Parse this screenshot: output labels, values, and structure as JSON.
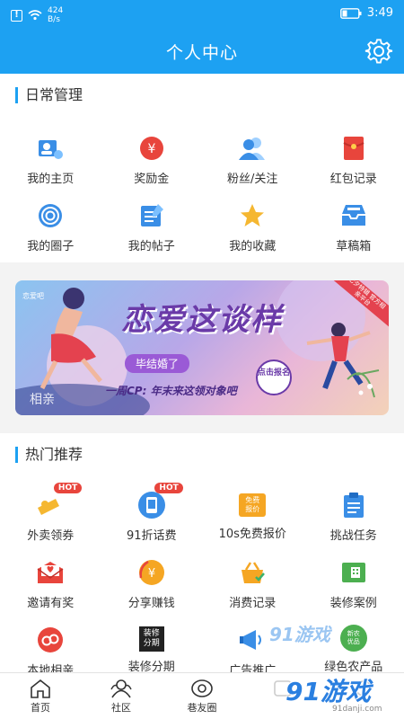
{
  "status": {
    "speed": "424",
    "speed_unit": "B/s",
    "time": "3:49"
  },
  "header": {
    "title": "个人中心"
  },
  "daily": {
    "title": "日常管理",
    "items": [
      {
        "label": "我的主页",
        "icon": "home-page-icon"
      },
      {
        "label": "奖励金",
        "icon": "yuan-coin-icon"
      },
      {
        "label": "粉丝/关注",
        "icon": "fans-icon"
      },
      {
        "label": "红包记录",
        "icon": "red-envelope-icon"
      },
      {
        "label": "我的圈子",
        "icon": "circle-target-icon"
      },
      {
        "label": "我的帖子",
        "icon": "post-icon"
      },
      {
        "label": "我的收藏",
        "icon": "star-icon"
      },
      {
        "label": "草稿箱",
        "icon": "draft-box-icon"
      }
    ]
  },
  "banner": {
    "headline": "恋爱这谈样",
    "sub_badge": "毕结婚了",
    "tagline": "一周CP: 年末来这领对象吧",
    "button": "点击报名",
    "corner_tag": "相亲",
    "logo": "恋爱吧",
    "ribbon": "七夕特辑 官方相亲平台"
  },
  "hot": {
    "title": "热门推荐",
    "badge": "HOT",
    "items": [
      {
        "label": "外卖领券",
        "icon": "takeout-coupon-icon",
        "hot": true
      },
      {
        "label": "91折话费",
        "icon": "phone-bill-icon",
        "hot": true
      },
      {
        "label": "10s免费报价",
        "icon": "free-quote-icon",
        "hot": false,
        "icon_text": "免费报价"
      },
      {
        "label": "挑战任务",
        "icon": "clipboard-task-icon",
        "hot": false
      },
      {
        "label": "邀请有奖",
        "icon": "invite-envelope-icon",
        "hot": false
      },
      {
        "label": "分享赚钱",
        "icon": "share-money-icon",
        "hot": false
      },
      {
        "label": "消费记录",
        "icon": "shopping-basket-icon",
        "hot": false
      },
      {
        "label": "装修案例",
        "icon": "decoration-case-icon",
        "hot": false
      },
      {
        "label": "本地相亲",
        "icon": "local-dating-icon",
        "hot": false
      },
      {
        "label": "装修分期",
        "icon": "decoration-installment-icon",
        "hot": false,
        "icon_text": "装修分期"
      },
      {
        "label": "广告推广",
        "icon": "ad-promotion-icon",
        "hot": false
      },
      {
        "label": "绿色农产品",
        "icon": "green-produce-icon",
        "hot": false,
        "icon_text": "新农优品"
      }
    ]
  },
  "tabs": [
    {
      "label": "首页",
      "icon": "home-tab-icon"
    },
    {
      "label": "社区",
      "icon": "community-tab-icon"
    },
    {
      "label": "巷友圈",
      "icon": "friends-circle-tab-icon"
    },
    {
      "label": "",
      "icon": "extra-tab-icon"
    },
    {
      "label": "",
      "icon": "extra-tab-icon"
    }
  ],
  "watermark": {
    "text": "91游戏",
    "url": "91danji.com"
  },
  "colors": {
    "primary": "#1da1f2",
    "accent_red": "#e8453c",
    "bg": "#f3f3f3"
  }
}
